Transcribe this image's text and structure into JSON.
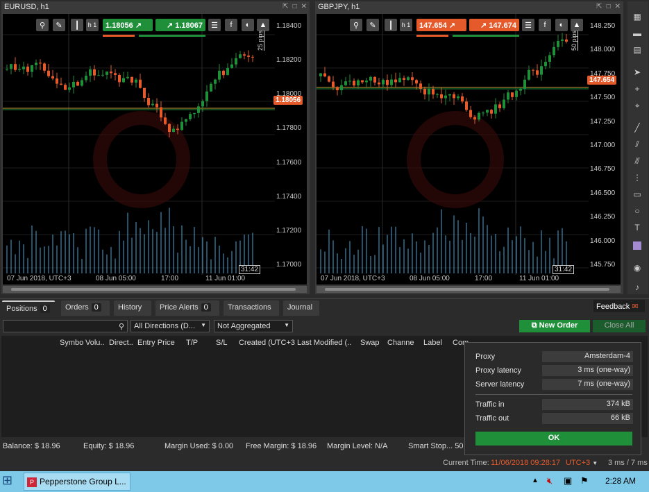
{
  "charts": [
    {
      "symbol": "EURUSD, h1",
      "bid": "1.18056",
      "ask": "1.18067",
      "timeframe": "h",
      "timeframe_sub": "1",
      "pips_label": "25 pips",
      "current_price": "1.18056",
      "prices": [
        "1.18400",
        "1.18200",
        "1.18000",
        "1.17800",
        "1.17600",
        "1.17400",
        "1.17200",
        "1.17000"
      ],
      "times": [
        "07 Jun 2018, UTC+3",
        "08 Jun 05:00",
        "17:00",
        "11 Jun 01:00"
      ],
      "timer": "31:42"
    },
    {
      "symbol": "GBPJPY, h1",
      "bid": "147.654",
      "ask": "147.674",
      "timeframe": "h",
      "timeframe_sub": "1",
      "pips_label": "50 pips",
      "current_price": "147.654",
      "prices": [
        "148.250",
        "148.000",
        "147.750",
        "147.500",
        "147.250",
        "147.000",
        "146.750",
        "146.500",
        "146.250",
        "146.000",
        "145.750"
      ],
      "times": [
        "07 Jun 2018, UTC+3",
        "08 Jun 05:00",
        "17:00",
        "11 Jun 01:00"
      ],
      "timer": "31:42"
    }
  ],
  "tabs": [
    {
      "label": "Positions",
      "count": "0"
    },
    {
      "label": "Orders",
      "count": "0"
    },
    {
      "label": "History"
    },
    {
      "label": "Price Alerts",
      "count": "0"
    },
    {
      "label": "Transactions"
    },
    {
      "label": "Journal"
    }
  ],
  "feedback_label": "Feedback",
  "filters": {
    "direction": "All Directions (D...",
    "aggregation": "Not Aggregated"
  },
  "new_order_label": "New Order",
  "close_all_label": "Close All",
  "columns": [
    "Symbo",
    "Volu..",
    "Direct..",
    "Entry Price",
    "T/P",
    "S/L",
    "Created (UTC+3",
    "Last Modified (..",
    "Swap",
    "Channe",
    "Label",
    "Com"
  ],
  "status_bar": {
    "balance": "Balance: $ 18.96",
    "equity": "Equity: $ 18.96",
    "margin_used": "Margin Used: $ 0.00",
    "free_margin": "Free Margin: $ 18.96",
    "margin_level": "Margin Level: N/A",
    "smart_stop": "Smart Stop...  50"
  },
  "current_time_label": "Current Time:",
  "current_time": "11/06/2018 09:28:17",
  "timezone": "UTC+3",
  "latency": "3 ms / 7 ms",
  "popup": {
    "rows": [
      {
        "label": "Proxy",
        "value": "Amsterdam-4"
      },
      {
        "label": "Proxy latency",
        "value": "3 ms (one-way)"
      },
      {
        "label": "Server latency",
        "value": "7 ms (one-way)"
      },
      {
        "label": "Traffic in",
        "value": "374 kB"
      },
      {
        "label": "Traffic out",
        "value": "66 kB"
      }
    ],
    "ok_label": "OK"
  },
  "taskbar": {
    "app_label": "Pepperstone Group L...",
    "clock": "2:28 AM"
  },
  "colors": {
    "bull": "#1f8f3a",
    "bear": "#e55a2b",
    "volume": "#4da6d9",
    "taskbar": "#7ec8e8"
  }
}
